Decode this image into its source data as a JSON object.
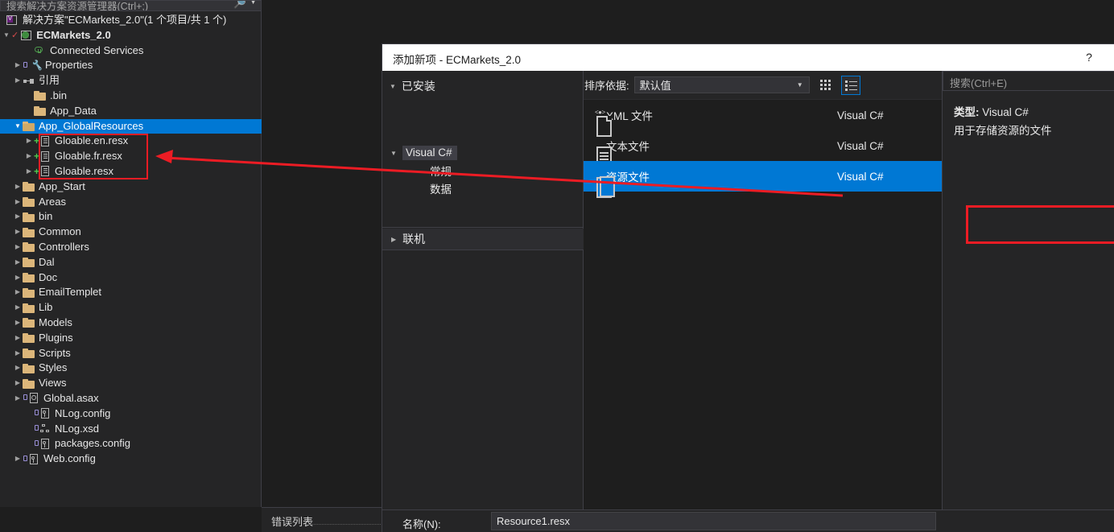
{
  "solution_explorer": {
    "search_placeholder": "搜索解决方案资源管理器(Ctrl+;)",
    "solution_label": "解决方案\"ECMarkets_2.0\"(1 个项目/共 1 个)",
    "tree": [
      {
        "label": "ECMarkets_2.0",
        "icon": "globe-project-icon",
        "indent": 0,
        "expander": "expanded",
        "bold": true,
        "check": true
      },
      {
        "label": "Connected Services",
        "icon": "cloud-icon",
        "indent": 2,
        "expander": "none"
      },
      {
        "label": "Properties",
        "icon": "wrench-icon",
        "indent": 1,
        "expander": "collapsed",
        "lock": true
      },
      {
        "label": "引用",
        "icon": "references-icon",
        "indent": 1,
        "expander": "collapsed"
      },
      {
        "label": ".bin",
        "icon": "folder-icon",
        "indent": 2,
        "expander": "none"
      },
      {
        "label": "App_Data",
        "icon": "folder-icon",
        "indent": 2,
        "expander": "none"
      },
      {
        "label": "App_GlobalResources",
        "icon": "folder-open-icon",
        "indent": 1,
        "expander": "expanded",
        "selected": true
      },
      {
        "label": "Gloable.en.resx",
        "icon": "resx-file-icon",
        "indent": 2,
        "expander": "collapsed",
        "plus": true
      },
      {
        "label": "Gloable.fr.resx",
        "icon": "resx-file-icon",
        "indent": 2,
        "expander": "collapsed",
        "plus": true
      },
      {
        "label": "Gloable.resx",
        "icon": "resx-file-icon",
        "indent": 2,
        "expander": "collapsed",
        "plus": true
      },
      {
        "label": "App_Start",
        "icon": "folder-icon",
        "indent": 1,
        "expander": "collapsed"
      },
      {
        "label": "Areas",
        "icon": "folder-icon",
        "indent": 1,
        "expander": "collapsed"
      },
      {
        "label": "bin",
        "icon": "folder-icon",
        "indent": 1,
        "expander": "collapsed"
      },
      {
        "label": "Common",
        "icon": "folder-icon",
        "indent": 1,
        "expander": "collapsed"
      },
      {
        "label": "Controllers",
        "icon": "folder-icon",
        "indent": 1,
        "expander": "collapsed"
      },
      {
        "label": "Dal",
        "icon": "folder-icon",
        "indent": 1,
        "expander": "collapsed"
      },
      {
        "label": "Doc",
        "icon": "folder-icon",
        "indent": 1,
        "expander": "collapsed"
      },
      {
        "label": "EmailTemplet",
        "icon": "folder-icon",
        "indent": 1,
        "expander": "collapsed"
      },
      {
        "label": "Lib",
        "icon": "folder-icon",
        "indent": 1,
        "expander": "collapsed"
      },
      {
        "label": "Models",
        "icon": "folder-icon",
        "indent": 1,
        "expander": "collapsed"
      },
      {
        "label": "Plugins",
        "icon": "folder-icon",
        "indent": 1,
        "expander": "collapsed"
      },
      {
        "label": "Scripts",
        "icon": "folder-icon",
        "indent": 1,
        "expander": "collapsed"
      },
      {
        "label": "Styles",
        "icon": "folder-icon",
        "indent": 1,
        "expander": "collapsed"
      },
      {
        "label": "Views",
        "icon": "folder-icon",
        "indent": 1,
        "expander": "collapsed"
      },
      {
        "label": "Global.asax",
        "icon": "asax-file-icon",
        "indent": 1,
        "expander": "collapsed",
        "lock": true
      },
      {
        "label": "NLog.config",
        "icon": "config-file-icon",
        "indent": 2,
        "expander": "none",
        "lock": true
      },
      {
        "label": "NLog.xsd",
        "icon": "xsd-file-icon",
        "indent": 2,
        "expander": "none",
        "lock": true
      },
      {
        "label": "packages.config",
        "icon": "config-file-icon",
        "indent": 2,
        "expander": "none",
        "lock": true
      },
      {
        "label": "Web.config",
        "icon": "config-file-icon",
        "indent": 1,
        "expander": "collapsed",
        "lock": true
      }
    ]
  },
  "bottom_dock": {
    "error_list_tab": "错误列表"
  },
  "dialog": {
    "title": "添加新项 - ECMarkets_2.0",
    "help_glyph": "?",
    "categories": {
      "installed_label": "已安装",
      "items": [
        {
          "label": "Visual C#",
          "expander": "expanded",
          "selected": true,
          "indent": 1
        },
        {
          "label": "常规",
          "expander": "none",
          "selected": false,
          "indent": 2
        },
        {
          "label": "数据",
          "expander": "none",
          "selected": false,
          "indent": 2
        }
      ],
      "online_label": "联机"
    },
    "sort": {
      "label": "排序依据:",
      "value": "默认值",
      "grid_view_icon": "grid-view-icon",
      "list_view_icon": "list-view-icon"
    },
    "items": [
      {
        "name": "XML 文件",
        "lang": "Visual C#",
        "icon": "xml-file-icon",
        "selected": false
      },
      {
        "name": "文本文件",
        "lang": "Visual C#",
        "icon": "text-file-icon",
        "selected": false
      },
      {
        "name": "资源文件",
        "lang": "Visual C#",
        "icon": "resource-file-icon",
        "selected": true
      }
    ],
    "search_placeholder": "搜索(Ctrl+E)",
    "details": {
      "type_label": "类型:",
      "type_value": "Visual C#",
      "description": "用于存储资源的文件"
    },
    "footer": {
      "name_label": "名称(N):",
      "name_value": "Resource1.resx"
    }
  },
  "annotations": {
    "accent_red": "#ec1c24",
    "selection_blue": "#0078d4"
  }
}
